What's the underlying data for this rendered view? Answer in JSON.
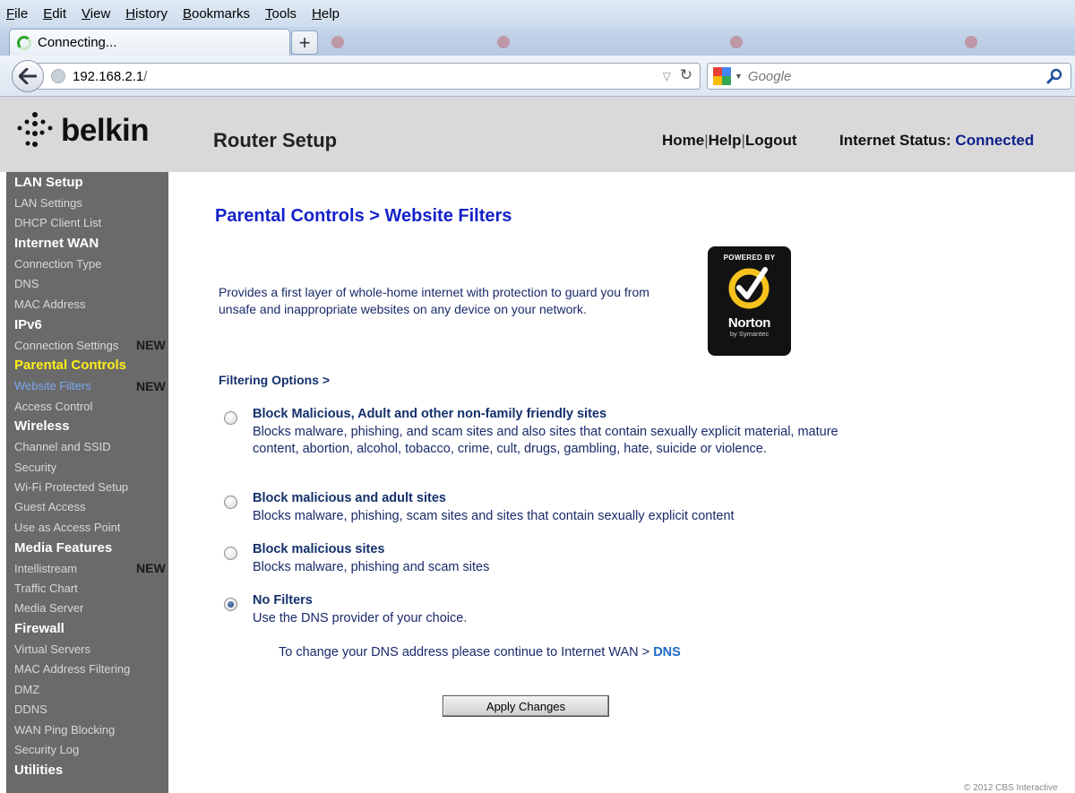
{
  "browser": {
    "menu": [
      "File",
      "Edit",
      "View",
      "History",
      "Bookmarks",
      "Tools",
      "Help"
    ],
    "tab_title": "Connecting...",
    "new_tab_symbol": "+",
    "url_host": "192.168.2.1",
    "url_path": "/",
    "search_placeholder": "Google"
  },
  "header": {
    "logo_text": "belkin",
    "title": "Router Setup",
    "links": [
      "Home",
      "Help",
      "Logout"
    ],
    "status_label": "Internet Status:",
    "status_value": "Connected",
    "status_color": "#10208a"
  },
  "sidebar": {
    "sections": [
      {
        "label": "LAN Setup",
        "items": [
          {
            "label": "LAN Settings"
          },
          {
            "label": "DHCP Client List"
          }
        ]
      },
      {
        "label": "Internet WAN",
        "items": [
          {
            "label": "Connection Type"
          },
          {
            "label": "DNS"
          },
          {
            "label": "MAC Address"
          }
        ]
      },
      {
        "label": "IPv6",
        "items": [
          {
            "label": "Connection Settings",
            "badge": "NEW"
          }
        ]
      },
      {
        "label": "Parental Controls",
        "active": true,
        "items": [
          {
            "label": "Website Filters",
            "badge": "NEW",
            "active": true
          },
          {
            "label": "Access Control"
          }
        ]
      },
      {
        "label": "Wireless",
        "items": [
          {
            "label": "Channel and SSID"
          },
          {
            "label": "Security"
          },
          {
            "label": "Wi-Fi Protected Setup"
          },
          {
            "label": "Guest Access"
          },
          {
            "label": "Use as Access Point"
          }
        ]
      },
      {
        "label": "Media Features",
        "items": [
          {
            "label": "Intellistream",
            "badge": "NEW"
          },
          {
            "label": "Traffic Chart"
          },
          {
            "label": "Media Server"
          }
        ]
      },
      {
        "label": "Firewall",
        "items": [
          {
            "label": "Virtual Servers"
          },
          {
            "label": "MAC Address Filtering"
          },
          {
            "label": "DMZ"
          },
          {
            "label": "DDNS"
          },
          {
            "label": "WAN Ping Blocking"
          },
          {
            "label": "Security Log"
          }
        ]
      },
      {
        "label": "Utilities",
        "items": []
      }
    ]
  },
  "main": {
    "page_title": "Parental Controls > Website Filters",
    "description": "Provides a first layer of whole-home internet with protection to guard you from unsafe and inappropriate websites on any device on your network.",
    "norton_badge": {
      "powered_by": "POWERED BY",
      "name": "Norton",
      "by": "by Symantec"
    },
    "filter_heading": "Filtering Options >",
    "options": [
      {
        "title": "Block Malicious, Adult and other non-family friendly sites",
        "description": "Blocks malware, phishing, and scam sites and also sites that contain sexually explicit material, mature content, abortion, alcohol, tobacco, crime, cult, drugs, gambling, hate, suicide or violence.",
        "checked": false
      },
      {
        "title": "Block malicious and adult sites",
        "description": "Blocks malware, phishing, scam sites and sites that contain sexually explicit content",
        "checked": false
      },
      {
        "title": "Block malicious sites",
        "description": "Blocks malware, phishing and scam sites",
        "checked": false
      },
      {
        "title": "No Filters",
        "description": "Use the DNS provider of your choice.",
        "checked": true
      }
    ],
    "dns_note": "To change your DNS address please continue to Internet WAN >",
    "dns_link": "DNS",
    "apply_label": "Apply Changes"
  },
  "footer": {
    "copyright": "© 2012 CBS Interactive"
  }
}
